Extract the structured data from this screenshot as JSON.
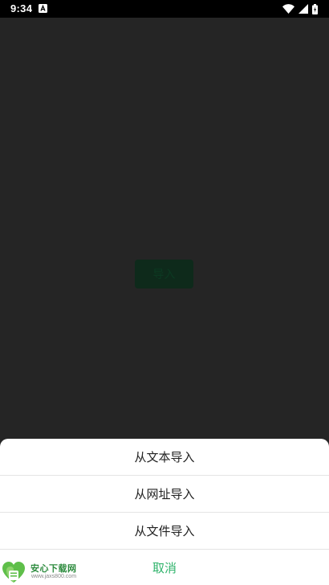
{
  "status_bar": {
    "time": "9:34",
    "icons": [
      "notification-a-icon",
      "wifi-icon",
      "signal-icon",
      "battery-icon"
    ]
  },
  "main": {
    "import_button_label": "导入"
  },
  "action_sheet": {
    "items": [
      {
        "label": "从文本导入"
      },
      {
        "label": "从网址导入"
      },
      {
        "label": "从文件导入"
      }
    ],
    "cancel_label": "取消"
  },
  "watermark": {
    "site_name": "安心下载网",
    "url": "www.jaxs800.com"
  },
  "colors": {
    "accent": "#2fb36b",
    "background": "#252525",
    "sheet": "#ffffff"
  }
}
